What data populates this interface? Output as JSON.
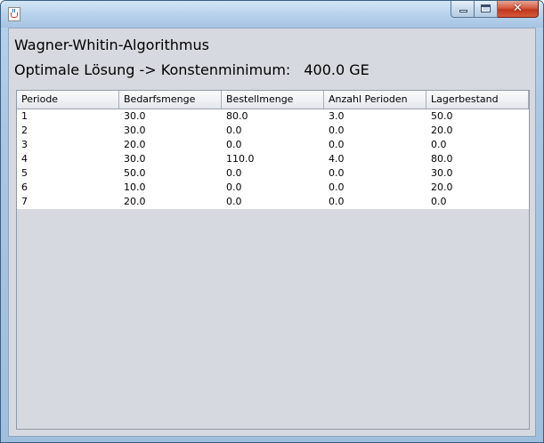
{
  "window": {
    "title": "",
    "icon": "java-icon",
    "buttons": {
      "minimize": "minimize-icon",
      "maximize": "maximize-icon",
      "close_glyph": "✕"
    }
  },
  "main": {
    "title": "Wagner-Whitin-Algorithmus",
    "solution_label": "Optimale Lösung -> Konstenminimum:",
    "solution_value": "400.0 GE"
  },
  "table": {
    "columns": [
      "Periode",
      "Bedarfsmenge",
      "Bestellmenge",
      "Anzahl Perioden",
      "Lagerbestand"
    ],
    "rows": [
      [
        "1",
        "30.0",
        "80.0",
        "3.0",
        "50.0"
      ],
      [
        "2",
        "30.0",
        "0.0",
        "0.0",
        "20.0"
      ],
      [
        "3",
        "20.0",
        "0.0",
        "0.0",
        "0.0"
      ],
      [
        "4",
        "30.0",
        "110.0",
        "4.0",
        "80.0"
      ],
      [
        "5",
        "50.0",
        "0.0",
        "0.0",
        "30.0"
      ],
      [
        "6",
        "10.0",
        "0.0",
        "0.0",
        "20.0"
      ],
      [
        "7",
        "20.0",
        "0.0",
        "0.0",
        "0.0"
      ]
    ]
  },
  "colors": {
    "client_background": "#d6d9df",
    "table_background": "#ffffff",
    "close_button": "#c0381d"
  }
}
